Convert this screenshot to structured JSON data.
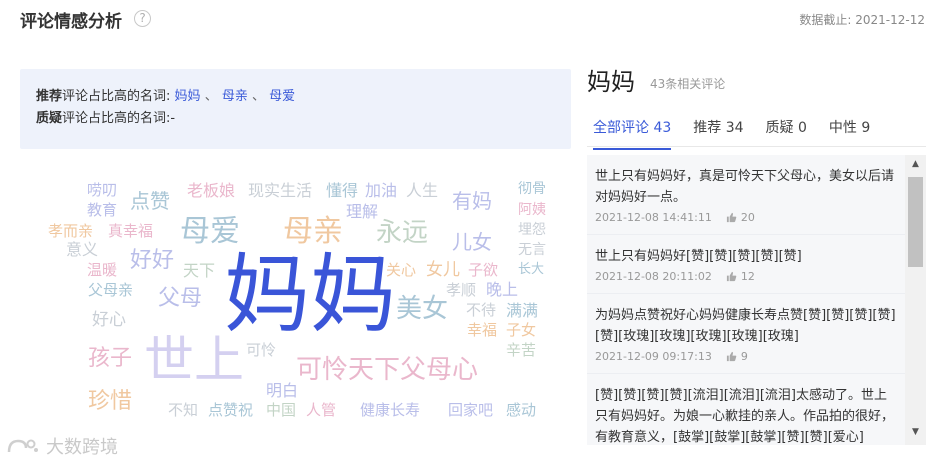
{
  "header": {
    "title": "评论情感分析",
    "help_glyph": "?",
    "date_note": "数据截止: 2021-12-12"
  },
  "summary": {
    "recommend_bold": "推荐",
    "recommend_rest": "评论占比高的名词:",
    "recommend_keywords": [
      "妈妈",
      "母亲",
      "母爱"
    ],
    "separator": "、",
    "doubt_bold": "质疑",
    "doubt_rest": "评论占比高的名词:",
    "doubt_value": "-"
  },
  "word_cloud": [
    {
      "text": "唠叨",
      "color": "#b9bee9",
      "size": 15
    },
    {
      "text": "教育",
      "color": "#b9bee9",
      "size": 15
    },
    {
      "text": "点赞",
      "color": "#a9c6d6",
      "size": 20
    },
    {
      "text": "老板娘",
      "color": "#eab7cc",
      "size": 16
    },
    {
      "text": "现实生活",
      "color": "#c9cfd6",
      "size": 16
    },
    {
      "text": "懂得",
      "color": "#a9c6d6",
      "size": 16
    },
    {
      "text": "加油",
      "color": "#b9bee9",
      "size": 16
    },
    {
      "text": "人生",
      "color": "#c9cfd6",
      "size": 16
    },
    {
      "text": "有妈",
      "color": "#b9bee9",
      "size": 20
    },
    {
      "text": "彻骨",
      "color": "#a9c6d6",
      "size": 14
    },
    {
      "text": "阿姨",
      "color": "#eab7cc",
      "size": 14
    },
    {
      "text": "理解",
      "color": "#b9bee9",
      "size": 16
    },
    {
      "text": "孝而亲",
      "color": "#f0c8a0",
      "size": 15
    },
    {
      "text": "真幸福",
      "color": "#eab7cc",
      "size": 15
    },
    {
      "text": "母爱",
      "color": "#a9c6d6",
      "size": 30
    },
    {
      "text": "母亲",
      "color": "#f0c8a0",
      "size": 30
    },
    {
      "text": "永远",
      "color": "#c3d4c6",
      "size": 26
    },
    {
      "text": "埋怨",
      "color": "#c9cfd6",
      "size": 14
    },
    {
      "text": "意义",
      "color": "#c9cfd6",
      "size": 16
    },
    {
      "text": "儿女",
      "color": "#b9bee9",
      "size": 20
    },
    {
      "text": "无言",
      "color": "#c9cfd6",
      "size": 14
    },
    {
      "text": "好好",
      "color": "#b9bee9",
      "size": 22
    },
    {
      "text": "温暖",
      "color": "#eab7cc",
      "size": 15
    },
    {
      "text": "天下",
      "color": "#c3d4c6",
      "size": 16
    },
    {
      "text": "妈妈",
      "color": "#3a55d8",
      "size": 86
    },
    {
      "text": "关心",
      "color": "#f0c8a0",
      "size": 15
    },
    {
      "text": "女儿",
      "color": "#f0c8a0",
      "size": 17
    },
    {
      "text": "子欲",
      "color": "#eab7cc",
      "size": 15
    },
    {
      "text": "长大",
      "color": "#a9c6d6",
      "size": 13
    },
    {
      "text": "父母亲",
      "color": "#a9c6d6",
      "size": 15
    },
    {
      "text": "父母",
      "color": "#b9bee9",
      "size": 22
    },
    {
      "text": "孝顺",
      "color": "#c9cfd6",
      "size": 15
    },
    {
      "text": "晚上",
      "color": "#b9bee9",
      "size": 16
    },
    {
      "text": "美女",
      "color": "#a9c6d6",
      "size": 26
    },
    {
      "text": "不待",
      "color": "#c9cfd6",
      "size": 15
    },
    {
      "text": "满满",
      "color": "#a9c6d6",
      "size": 16
    },
    {
      "text": "好心",
      "color": "#c9cfd6",
      "size": 17
    },
    {
      "text": "幸福",
      "color": "#f0c8a0",
      "size": 15
    },
    {
      "text": "子女",
      "color": "#f0c8a0",
      "size": 15
    },
    {
      "text": "孩子",
      "color": "#eab7cc",
      "size": 22
    },
    {
      "text": "世上",
      "color": "#d4d0f0",
      "size": 50
    },
    {
      "text": "可怜",
      "color": "#c9cfd6",
      "size": 15
    },
    {
      "text": "可怜天下父母心",
      "color": "#eab7cc",
      "size": 26
    },
    {
      "text": "辛苦",
      "color": "#c3d4c6",
      "size": 15
    },
    {
      "text": "明白",
      "color": "#b9bee9",
      "size": 16
    },
    {
      "text": "珍惜",
      "color": "#f0c8a0",
      "size": 22
    },
    {
      "text": "不知",
      "color": "#c9cfd6",
      "size": 15
    },
    {
      "text": "点赞祝",
      "color": "#a9c6d6",
      "size": 15
    },
    {
      "text": "中国",
      "color": "#c3d4c6",
      "size": 15
    },
    {
      "text": "人管",
      "color": "#eab7cc",
      "size": 15
    },
    {
      "text": "健康长寿",
      "color": "#b9bee9",
      "size": 15
    },
    {
      "text": "回家吧",
      "color": "#b9bee9",
      "size": 15
    },
    {
      "text": "感动",
      "color": "#a9c6d6",
      "size": 15
    }
  ],
  "watermark": {
    "text": "大数跨境"
  },
  "keyword_panel": {
    "title": "妈妈",
    "count": "43条相关评论",
    "tabs": [
      {
        "label": "全部评论 43",
        "active": true
      },
      {
        "label": "推荐 34",
        "active": false
      },
      {
        "label": "质疑 0",
        "active": false
      },
      {
        "label": "中性 9",
        "active": false
      }
    ],
    "comments": [
      {
        "text": "世上只有妈妈好，真是可怜天下父母心，美女以后请对妈妈好一点。",
        "time": "2021-12-08 14:41:11",
        "likes": "20"
      },
      {
        "text": "世上只有妈妈好[赞][赞][赞][赞][赞]",
        "time": "2021-12-08 20:11:02",
        "likes": "12"
      },
      {
        "text": "为妈妈点赞祝好心妈妈健康长寿点赞[赞][赞][赞][赞][赞][玫瑰][玫瑰][玫瑰][玫瑰][玫瑰]",
        "time": "2021-12-09 09:17:13",
        "likes": "9"
      },
      {
        "text": "[赞][赞][赞][赞][流泪][流泪][流泪]太感动了。世上只有妈妈好。为娘一心歉挂的亲人。作品拍的很好，有教育意义，[鼓掌][鼓掌][鼓掌][赞][赞][爱心]",
        "time": "",
        "likes": ""
      }
    ],
    "scroll_up": "▲",
    "scroll_down": "▼"
  }
}
